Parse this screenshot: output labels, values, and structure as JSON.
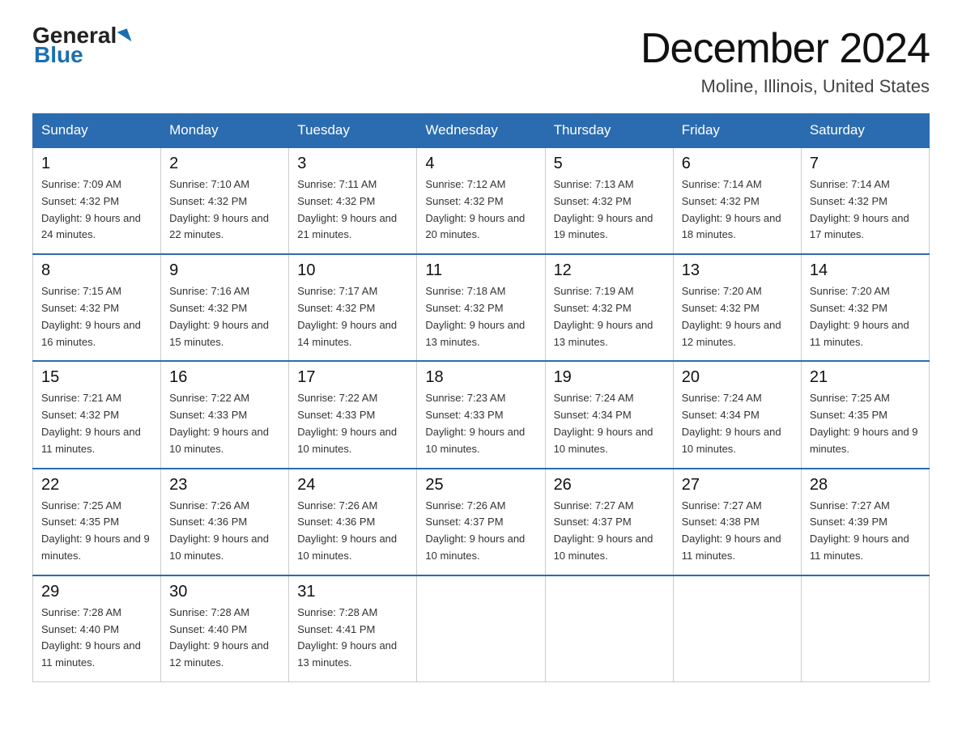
{
  "logo": {
    "general": "General",
    "blue": "Blue"
  },
  "title": "December 2024",
  "subtitle": "Moline, Illinois, United States",
  "weekdays": [
    "Sunday",
    "Monday",
    "Tuesday",
    "Wednesday",
    "Thursday",
    "Friday",
    "Saturday"
  ],
  "weeks": [
    [
      {
        "day": "1",
        "sunrise": "7:09 AM",
        "sunset": "4:32 PM",
        "daylight": "9 hours and 24 minutes."
      },
      {
        "day": "2",
        "sunrise": "7:10 AM",
        "sunset": "4:32 PM",
        "daylight": "9 hours and 22 minutes."
      },
      {
        "day": "3",
        "sunrise": "7:11 AM",
        "sunset": "4:32 PM",
        "daylight": "9 hours and 21 minutes."
      },
      {
        "day": "4",
        "sunrise": "7:12 AM",
        "sunset": "4:32 PM",
        "daylight": "9 hours and 20 minutes."
      },
      {
        "day": "5",
        "sunrise": "7:13 AM",
        "sunset": "4:32 PM",
        "daylight": "9 hours and 19 minutes."
      },
      {
        "day": "6",
        "sunrise": "7:14 AM",
        "sunset": "4:32 PM",
        "daylight": "9 hours and 18 minutes."
      },
      {
        "day": "7",
        "sunrise": "7:14 AM",
        "sunset": "4:32 PM",
        "daylight": "9 hours and 17 minutes."
      }
    ],
    [
      {
        "day": "8",
        "sunrise": "7:15 AM",
        "sunset": "4:32 PM",
        "daylight": "9 hours and 16 minutes."
      },
      {
        "day": "9",
        "sunrise": "7:16 AM",
        "sunset": "4:32 PM",
        "daylight": "9 hours and 15 minutes."
      },
      {
        "day": "10",
        "sunrise": "7:17 AM",
        "sunset": "4:32 PM",
        "daylight": "9 hours and 14 minutes."
      },
      {
        "day": "11",
        "sunrise": "7:18 AM",
        "sunset": "4:32 PM",
        "daylight": "9 hours and 13 minutes."
      },
      {
        "day": "12",
        "sunrise": "7:19 AM",
        "sunset": "4:32 PM",
        "daylight": "9 hours and 13 minutes."
      },
      {
        "day": "13",
        "sunrise": "7:20 AM",
        "sunset": "4:32 PM",
        "daylight": "9 hours and 12 minutes."
      },
      {
        "day": "14",
        "sunrise": "7:20 AM",
        "sunset": "4:32 PM",
        "daylight": "9 hours and 11 minutes."
      }
    ],
    [
      {
        "day": "15",
        "sunrise": "7:21 AM",
        "sunset": "4:32 PM",
        "daylight": "9 hours and 11 minutes."
      },
      {
        "day": "16",
        "sunrise": "7:22 AM",
        "sunset": "4:33 PM",
        "daylight": "9 hours and 10 minutes."
      },
      {
        "day": "17",
        "sunrise": "7:22 AM",
        "sunset": "4:33 PM",
        "daylight": "9 hours and 10 minutes."
      },
      {
        "day": "18",
        "sunrise": "7:23 AM",
        "sunset": "4:33 PM",
        "daylight": "9 hours and 10 minutes."
      },
      {
        "day": "19",
        "sunrise": "7:24 AM",
        "sunset": "4:34 PM",
        "daylight": "9 hours and 10 minutes."
      },
      {
        "day": "20",
        "sunrise": "7:24 AM",
        "sunset": "4:34 PM",
        "daylight": "9 hours and 10 minutes."
      },
      {
        "day": "21",
        "sunrise": "7:25 AM",
        "sunset": "4:35 PM",
        "daylight": "9 hours and 9 minutes."
      }
    ],
    [
      {
        "day": "22",
        "sunrise": "7:25 AM",
        "sunset": "4:35 PM",
        "daylight": "9 hours and 9 minutes."
      },
      {
        "day": "23",
        "sunrise": "7:26 AM",
        "sunset": "4:36 PM",
        "daylight": "9 hours and 10 minutes."
      },
      {
        "day": "24",
        "sunrise": "7:26 AM",
        "sunset": "4:36 PM",
        "daylight": "9 hours and 10 minutes."
      },
      {
        "day": "25",
        "sunrise": "7:26 AM",
        "sunset": "4:37 PM",
        "daylight": "9 hours and 10 minutes."
      },
      {
        "day": "26",
        "sunrise": "7:27 AM",
        "sunset": "4:37 PM",
        "daylight": "9 hours and 10 minutes."
      },
      {
        "day": "27",
        "sunrise": "7:27 AM",
        "sunset": "4:38 PM",
        "daylight": "9 hours and 11 minutes."
      },
      {
        "day": "28",
        "sunrise": "7:27 AM",
        "sunset": "4:39 PM",
        "daylight": "9 hours and 11 minutes."
      }
    ],
    [
      {
        "day": "29",
        "sunrise": "7:28 AM",
        "sunset": "4:40 PM",
        "daylight": "9 hours and 11 minutes."
      },
      {
        "day": "30",
        "sunrise": "7:28 AM",
        "sunset": "4:40 PM",
        "daylight": "9 hours and 12 minutes."
      },
      {
        "day": "31",
        "sunrise": "7:28 AM",
        "sunset": "4:41 PM",
        "daylight": "9 hours and 13 minutes."
      },
      null,
      null,
      null,
      null
    ]
  ],
  "labels": {
    "sunrise": "Sunrise:",
    "sunset": "Sunset:",
    "daylight": "Daylight:"
  }
}
